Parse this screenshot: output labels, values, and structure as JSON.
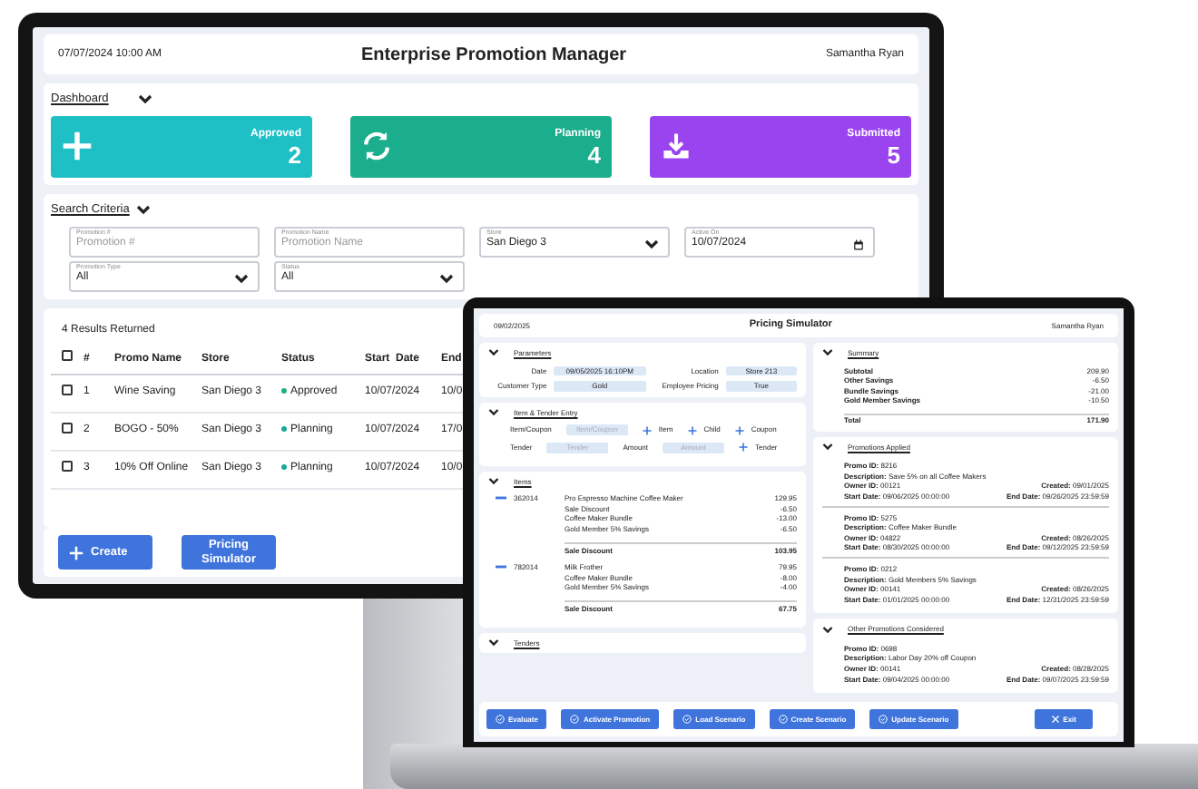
{
  "monitor": {
    "header": {
      "datetime": "07/07/2024 10:00 AM",
      "title": "Enterprise Promotion Manager",
      "user": "Samantha Ryan"
    },
    "dashboard": {
      "label": "Dashboard",
      "tiles": [
        {
          "label": "Approved",
          "count": "2",
          "color": "#1fbfc6"
        },
        {
          "label": "Planning",
          "count": "4",
          "color": "#1bae8d"
        },
        {
          "label": "Submitted",
          "count": "5",
          "color": "#9a44f0"
        }
      ]
    },
    "search": {
      "label": "Search Criteria",
      "fields": [
        {
          "kind": "text",
          "label": "Promotion #",
          "placeholder": "Promotion #"
        },
        {
          "kind": "text",
          "label": "Promotion Name",
          "placeholder": "Promotion Name"
        },
        {
          "kind": "select",
          "label": "Store",
          "value": "San Diego 3"
        },
        {
          "kind": "date",
          "label": "Active On",
          "value": "10/07/2024"
        },
        {
          "kind": "select",
          "label": "Promotion Type",
          "value": "All"
        },
        {
          "kind": "select",
          "label": "Status",
          "value": "All"
        }
      ]
    },
    "results": {
      "count": "4 Results Returned",
      "all_checked": false,
      "columns": [
        "#",
        "Promo Name",
        "Store",
        "Status",
        "Start  Date",
        "End"
      ],
      "rows": [
        {
          "checked": false,
          "cells": [
            "1",
            "Wine Saving",
            "San Diego 3",
            "Approved",
            "10/07/2024",
            "10/0"
          ],
          "color": "#22b07d"
        },
        {
          "checked": false,
          "cells": [
            "2",
            "BOGO - 50%",
            "San Diego 3",
            "Planning",
            "10/07/2024",
            "17/0"
          ],
          "color": "#19a89a"
        },
        {
          "checked": false,
          "cells": [
            "3",
            "10% Off Online",
            "San Diego 3",
            "Planning",
            "10/07/2024",
            "10/0"
          ],
          "color": "#19a89a"
        }
      ]
    },
    "buttons": [
      "Create",
      "Pricing Simulator"
    ]
  },
  "laptop": {
    "header": {
      "date": "09/02/2025",
      "title": "Pricing Simulator",
      "user": "Samantha Ryan"
    },
    "parameters": {
      "label": "Parameters",
      "fields": [
        {
          "label": "Date",
          "value": "09/05/2025 16:10PM"
        },
        {
          "label": "Location",
          "value": "Store 213"
        },
        {
          "label": "Customer Type",
          "value": "Gold"
        },
        {
          "label": "Employee Pricing",
          "value": "True"
        }
      ]
    },
    "entry": {
      "label": "Item & Tender Entry",
      "rows": [
        [
          {
            "kind": "label",
            "text": "Item/Coupon"
          },
          {
            "kind": "input",
            "placeholder": "Item/Coupon"
          },
          {
            "kind": "add",
            "text": "Item"
          },
          {
            "kind": "add",
            "text": "Child"
          },
          {
            "kind": "add",
            "text": "Coupon"
          }
        ],
        [
          {
            "kind": "label",
            "text": "Tender"
          },
          {
            "kind": "input",
            "placeholder": "Tender"
          },
          {
            "kind": "label",
            "text": "Amount"
          },
          {
            "kind": "input",
            "placeholder": "Amount"
          },
          {
            "kind": "add",
            "text": "Tender"
          }
        ]
      ]
    },
    "items": {
      "label": "Items",
      "groups": [
        {
          "id": "362014",
          "lines": [
            [
              "Pro Espresso Machine Coffee Maker",
              "129.95"
            ],
            [
              "Sale Discount",
              "-6.50"
            ],
            [
              "Coffee Maker Bundle",
              "-13.00"
            ],
            [
              "Gold Member 5% Savings",
              "-6.50"
            ]
          ],
          "total": [
            "Sale Discount",
            "103.95"
          ]
        },
        {
          "id": "782014",
          "lines": [
            [
              "Milk Frother",
              "79.95"
            ],
            [
              "Coffee Maker Bundle",
              "-8.00"
            ],
            [
              "Gold Member 5% Savings",
              "-4.00"
            ]
          ],
          "total": [
            "Sale Discount",
            "67.75"
          ]
        }
      ]
    },
    "tenders": {
      "label": "Tenders"
    },
    "summary": {
      "label": "Summary",
      "lines": [
        [
          "Subtotal",
          "209.90"
        ],
        [
          "Other Savings",
          "-6.50"
        ],
        [
          "Bundle Savings",
          "-21.00"
        ],
        [
          "Gold Member Savings",
          "-10.50"
        ]
      ],
      "total": [
        "Total",
        "171.90"
      ]
    },
    "applied": {
      "label": "Promotions Applied",
      "promos": [
        [
          [
            "Promo ID:",
            "8216"
          ],
          [
            "Description:",
            "Save 5% on all Coffee Makers"
          ],
          [
            "Owner ID:",
            "00121"
          ],
          [
            "Created:",
            "09/01/2025"
          ],
          [
            "Start Date:",
            "09/06/2025 00:00:00"
          ],
          [
            "End Date:",
            "09/26/2025 23:59:59"
          ]
        ],
        [
          [
            "Promo ID:",
            "5275"
          ],
          [
            "Description:",
            "Coffee Maker Bundle"
          ],
          [
            "Owner ID:",
            "04822"
          ],
          [
            "Created:",
            "08/26/2025"
          ],
          [
            "Start Date:",
            "08/30/2025 00:00:00"
          ],
          [
            "End Date:",
            "09/12/2025 23:59:59"
          ]
        ],
        [
          [
            "Promo ID:",
            "0212"
          ],
          [
            "Description:",
            "Gold Members 5% Savings"
          ],
          [
            "Owner ID:",
            "00141"
          ],
          [
            "Created:",
            "08/26/2025"
          ],
          [
            "Start Date:",
            "01/01/2025 00:00:00"
          ],
          [
            "End Date:",
            "12/31/2025 23:59:59"
          ]
        ]
      ]
    },
    "other": {
      "label": "Other Promotions Considered",
      "promos": [
        [
          [
            "Promo ID:",
            "0698"
          ],
          [
            "Description:",
            "Labor Day 20% off Coupon"
          ],
          [
            "Owner ID:",
            "00141"
          ],
          [
            "Created:",
            "08/28/2025"
          ],
          [
            "Start Date:",
            "09/04/2025 00:00:00"
          ],
          [
            "End Date:",
            "09/07/2025 23:59:59"
          ]
        ]
      ]
    },
    "buttons": [
      {
        "kind": "action",
        "label": "Evaluate"
      },
      {
        "kind": "action",
        "label": "Activate Promotion"
      },
      {
        "kind": "action",
        "label": "Load Scenario"
      },
      {
        "kind": "action",
        "label": "Create Scenario"
      },
      {
        "kind": "action",
        "label": "Update Scenario"
      },
      {
        "kind": "exit",
        "label": "Exit"
      }
    ]
  }
}
